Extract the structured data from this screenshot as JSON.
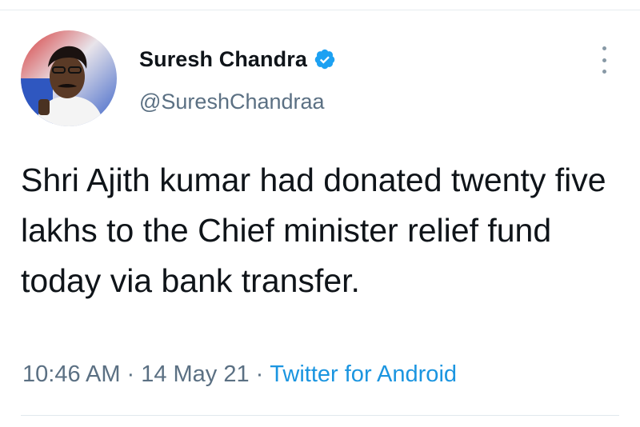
{
  "author": {
    "display_name": "Suresh Chandra",
    "handle": "@SureshChandraa",
    "verified": true
  },
  "tweet": {
    "text": "Shri Ajith kumar had donated twenty five lakhs to the Chief minister relief fund today via bank transfer."
  },
  "meta": {
    "time": "10:46 AM",
    "separator": "·",
    "date": "14 May 21",
    "source": "Twitter for Android"
  },
  "icons": {
    "verified": "verified-badge-icon",
    "more": "more-options-icon"
  },
  "colors": {
    "text": "#0f1419",
    "secondary": "#5b7083",
    "link": "#1b95e0",
    "verified": "#1da1f2"
  }
}
